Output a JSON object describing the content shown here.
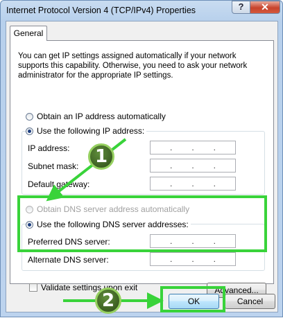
{
  "window": {
    "title": "Internet Protocol Version 4 (TCP/IPv4) Properties",
    "help_label": "?",
    "close_label": "X"
  },
  "tabs": [
    {
      "label": "General"
    }
  ],
  "description": "You can get IP settings assigned automatically if your network supports this capability. Otherwise, you need to ask your network administrator for the appropriate IP settings.",
  "ip": {
    "auto_label": "Obtain an IP address automatically",
    "manual_label": "Use the following IP address:",
    "address_label": "IP address:",
    "subnet_label": "Subnet mask:",
    "gateway_label": "Default gateway:",
    "address_value": ". . .",
    "subnet_value": ". . .",
    "gateway_value": ". . ."
  },
  "dns": {
    "auto_label": "Obtain DNS server address automatically",
    "manual_label": "Use the following DNS server addresses:",
    "preferred_label": "Preferred DNS server:",
    "alternate_label": "Alternate DNS server:"
  },
  "validate_label": "Validate settings upon exit",
  "buttons": {
    "advanced": "Advanced...",
    "ok": "OK",
    "cancel": "Cancel"
  },
  "annotations": {
    "step1": "1",
    "step2": "2",
    "highlight_color": "#39d33a"
  }
}
